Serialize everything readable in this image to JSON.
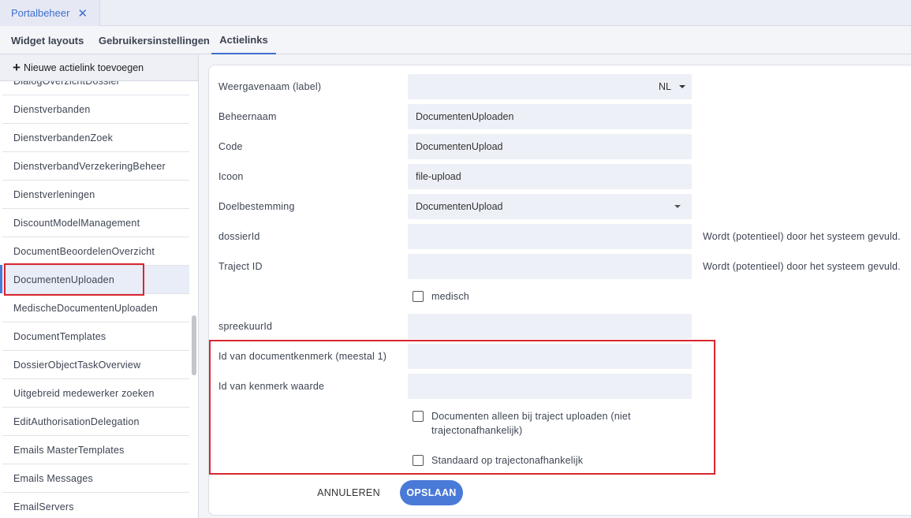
{
  "window": {
    "tab_label": "Portalbeheer",
    "tab_close": "✕"
  },
  "sub_tabs": [
    {
      "label": "Widget layouts",
      "active": false
    },
    {
      "label": "Gebruikersinstellingen",
      "active": false
    },
    {
      "label": "Actielinks",
      "active": true
    }
  ],
  "sidebar": {
    "new_button_label": "Nieuwe actielink toevoegen",
    "items": [
      "DialogOverzichtDossier",
      "Dienstverbanden",
      "DienstverbandenZoek",
      "DienstverbandVerzekeringBeheer",
      "Dienstverleningen",
      "DiscountModelManagement",
      "DocumentBeoordelenOverzicht",
      "DocumentenUploaden",
      "MedischeDocumentenUploaden",
      "DocumentTemplates",
      "DossierObjectTaskOverview",
      "Uitgebreid medewerker zoeken",
      "EditAuthorisationDelegation",
      "Emails MasterTemplates",
      "Emails Messages",
      "EmailServers"
    ],
    "selected_index": 7
  },
  "form": {
    "weergavenaam": {
      "label": "Weergavenaam (label)",
      "language": "NL"
    },
    "beheernaam": {
      "label": "Beheernaam",
      "value": "DocumentenUploaden"
    },
    "code": {
      "label": "Code",
      "value": "DocumentenUpload"
    },
    "icoon": {
      "label": "Icoon",
      "value": "file-upload"
    },
    "doelbestemming": {
      "label": "Doelbestemming",
      "value": "DocumentenUpload"
    },
    "dossierid": {
      "label": "dossierId",
      "value": "",
      "hint": "Wordt (potentieel) door het systeem gevuld."
    },
    "trajectid": {
      "label": "Traject ID",
      "value": "",
      "hint": "Wordt (potentieel) door het systeem gevuld."
    },
    "medisch": {
      "label": "medisch",
      "checked": false
    },
    "spreekuurid": {
      "label": "spreekuurId",
      "value": ""
    },
    "documentkenmerk": {
      "label": "Id van documentkenmerk (meestal 1)",
      "value": ""
    },
    "kenmerkwaarde": {
      "label": "Id van kenmerk waarde",
      "value": ""
    },
    "alleen_traject": {
      "label": "Documenten alleen bij traject uploaden (niet trajectonafhankelijk)",
      "checked": false
    },
    "standaard": {
      "label": "Standaard op trajectonafhankelijk",
      "checked": false
    }
  },
  "actions": {
    "cancel_label": "ANNULEREN",
    "save_label": "OPSLAAN"
  },
  "colors": {
    "accent": "#4a7ad8",
    "highlight_box": "#d8262f"
  }
}
